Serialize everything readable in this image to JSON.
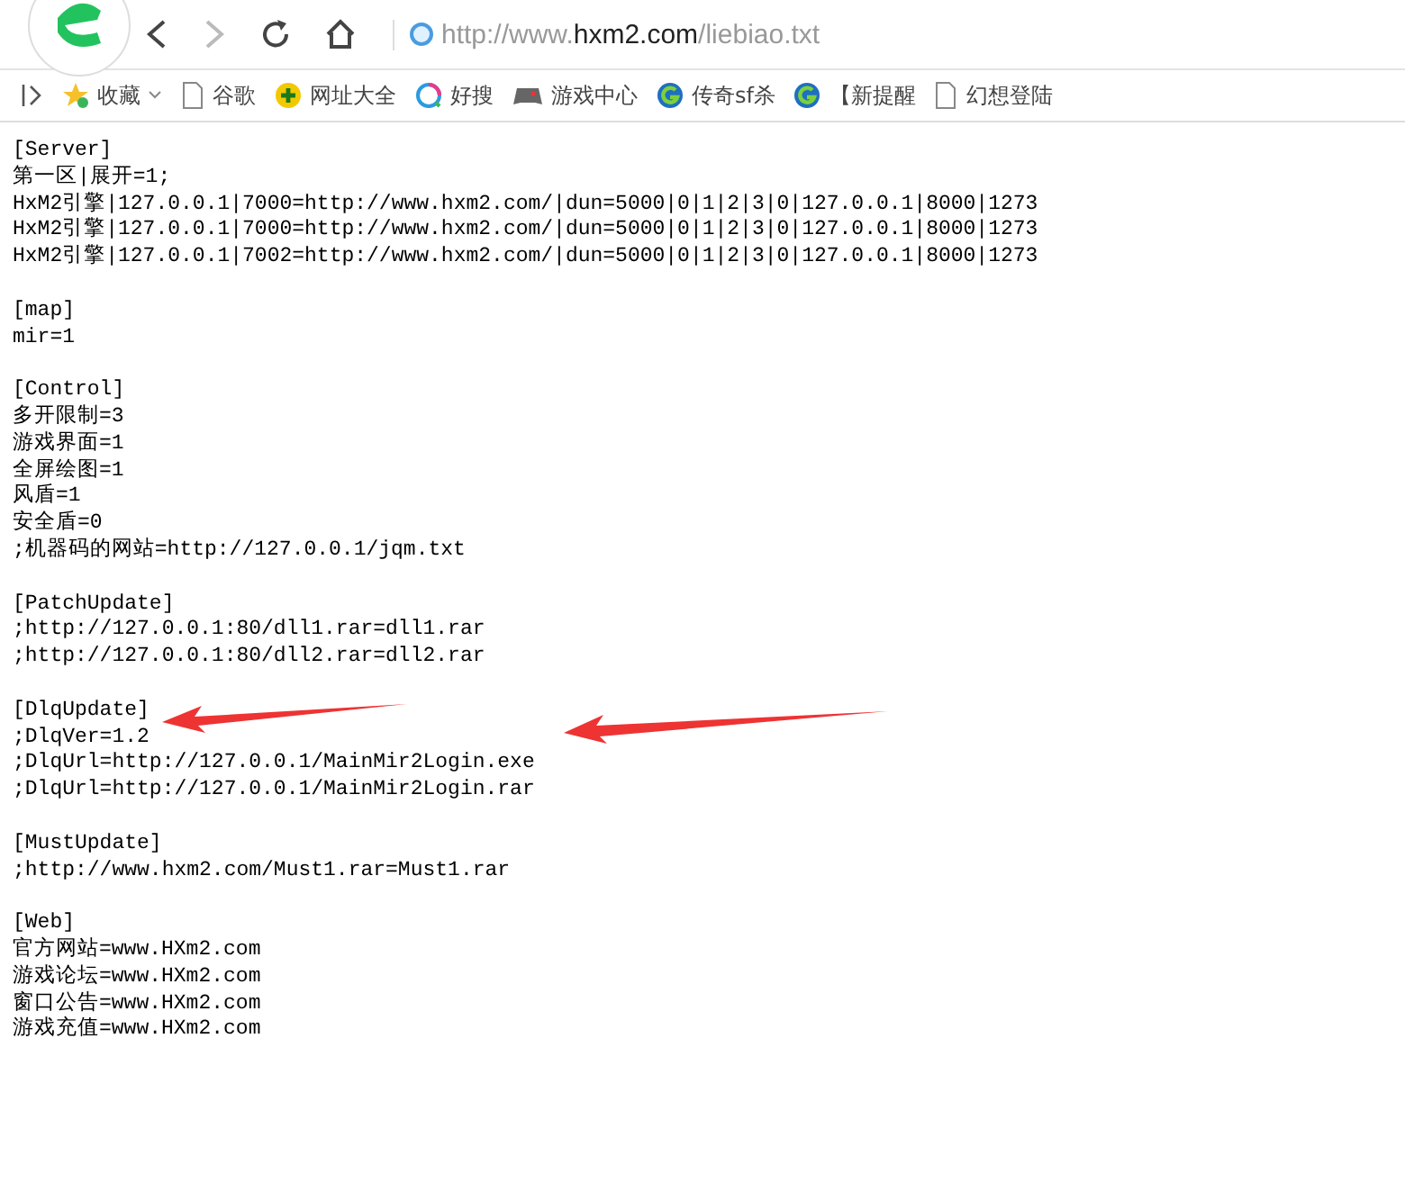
{
  "address_bar": {
    "url_start": "http://www.",
    "url_domain": "hxm2.com",
    "url_path": "/liebiao.txt"
  },
  "bookmarks": [
    {
      "kind": "star",
      "label": "收藏",
      "dropdown": true
    },
    {
      "kind": "page",
      "label": "谷歌",
      "dropdown": false
    },
    {
      "kind": "plus",
      "label": "网址大全",
      "dropdown": false
    },
    {
      "kind": "ring",
      "label": "好搜",
      "dropdown": false
    },
    {
      "kind": "gamepad",
      "label": "游戏中心",
      "dropdown": false
    },
    {
      "kind": "g",
      "label": "传奇sf杀",
      "dropdown": false
    },
    {
      "kind": "g",
      "label": "【新提醒",
      "dropdown": false
    },
    {
      "kind": "page",
      "label": "幻想登陆",
      "dropdown": false
    }
  ],
  "document": {
    "sections": [
      {
        "lines": [
          "[Server]",
          "第一区|展开=1;",
          "HxM2引擎|127.0.0.1|7000=http://www.hxm2.com/|dun=5000|0|1|2|3|0|127.0.0.1|8000|1273",
          "HxM2引擎|127.0.0.1|7000=http://www.hxm2.com/|dun=5000|0|1|2|3|0|127.0.0.1|8000|1273",
          "HxM2引擎|127.0.0.1|7002=http://www.hxm2.com/|dun=5000|0|1|2|3|0|127.0.0.1|8000|1273"
        ]
      },
      {
        "lines": [
          "[map]",
          "mir=1"
        ]
      },
      {
        "lines": [
          "[Control]",
          "多开限制=3",
          "游戏界面=1",
          "全屏绘图=1",
          "风盾=1",
          "安全盾=0",
          ";机器码的网站=http://127.0.0.1/jqm.txt"
        ]
      },
      {
        "lines": [
          "[PatchUpdate]",
          ";http://127.0.0.1:80/dll1.rar=dll1.rar",
          ";http://127.0.0.1:80/dll2.rar=dll2.rar"
        ]
      },
      {
        "lines": [
          "[DlqUpdate]",
          ";DlqVer=1.2",
          ";DlqUrl=http://127.0.0.1/MainMir2Login.exe",
          ";DlqUrl=http://127.0.0.1/MainMir2Login.rar"
        ]
      },
      {
        "lines": [
          "[MustUpdate]",
          ";http://www.hxm2.com/Must1.rar=Must1.rar"
        ]
      },
      {
        "lines": [
          "[Web]",
          "官方网站=www.HXm2.com",
          "游戏论坛=www.HXm2.com",
          "窗口公告=www.HXm2.com",
          "游戏充值=www.HXm2.com"
        ]
      }
    ]
  }
}
